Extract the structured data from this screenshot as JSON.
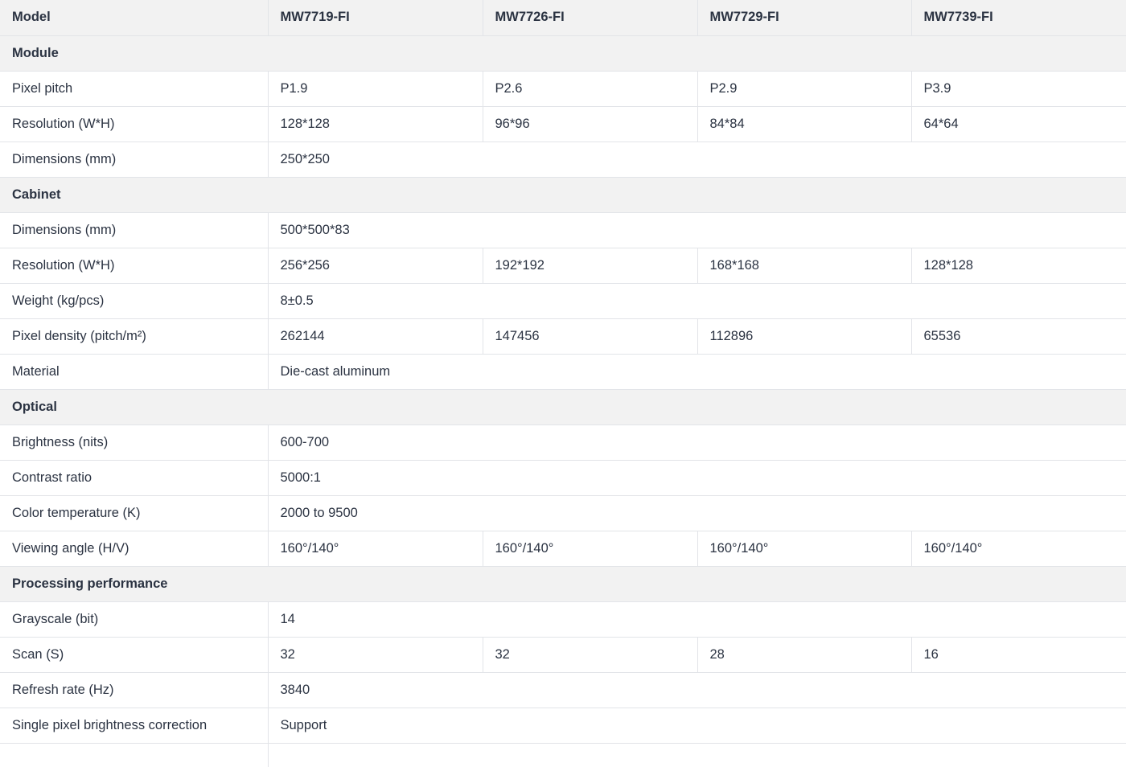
{
  "header": {
    "label": "Model",
    "models": [
      "MW7719-FI",
      "MW7726-FI",
      "MW7729-FI",
      "MW7739-FI"
    ]
  },
  "sections": [
    {
      "title": "Module",
      "rows": [
        {
          "label": "Pixel pitch",
          "values": [
            "P1.9",
            "P2.6",
            "P2.9",
            "P3.9"
          ]
        },
        {
          "label": "Resolution (W*H)",
          "values": [
            "128*128",
            "96*96",
            "84*84",
            "64*64"
          ]
        },
        {
          "label": "Dimensions (mm)",
          "values": [
            "250*250"
          ]
        }
      ]
    },
    {
      "title": "Cabinet",
      "rows": [
        {
          "label": "Dimensions (mm)",
          "values": [
            "500*500*83"
          ]
        },
        {
          "label": "Resolution (W*H)",
          "values": [
            "256*256",
            "192*192",
            "168*168",
            "128*128"
          ]
        },
        {
          "label": "Weight (kg/pcs)",
          "values": [
            "8±0.5"
          ]
        },
        {
          "label": "Pixel density (pitch/m²)",
          "values": [
            "262144",
            "147456",
            "112896",
            "65536"
          ]
        },
        {
          "label": "Material",
          "values": [
            "Die-cast aluminum"
          ]
        }
      ]
    },
    {
      "title": "Optical",
      "rows": [
        {
          "label": "Brightness (nits)",
          "values": [
            "600-700"
          ]
        },
        {
          "label": "Contrast ratio",
          "values": [
            "5000:1"
          ]
        },
        {
          "label": "Color temperature (K)",
          "values": [
            "2000 to 9500"
          ]
        },
        {
          "label": "Viewing angle (H/V)",
          "values": [
            "160°/140°",
            "160°/140°",
            "160°/140°",
            "160°/140°"
          ]
        }
      ]
    },
    {
      "title": "Processing performance",
      "rows": [
        {
          "label": "Grayscale (bit)",
          "values": [
            "14"
          ]
        },
        {
          "label": "Scan (S)",
          "values": [
            "32",
            "32",
            "28",
            "16"
          ]
        },
        {
          "label": "Refresh rate (Hz)",
          "values": [
            "3840"
          ]
        },
        {
          "label": "Single pixel brightness correction",
          "values": [
            "Support"
          ]
        }
      ]
    }
  ]
}
